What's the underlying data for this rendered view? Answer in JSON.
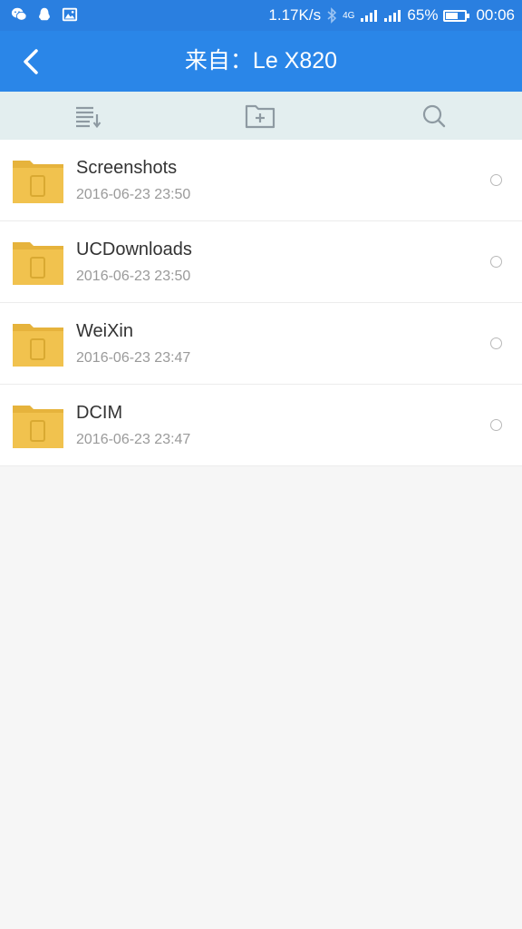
{
  "status_bar": {
    "speed": "1.17K/s",
    "network": "4G",
    "battery_percent": "65%",
    "battery_level": 0.65,
    "time": "00:06",
    "icons": [
      "wechat-icon",
      "qq-icon",
      "gallery-icon",
      "bluetooth-icon",
      "signal-icon",
      "battery-icon"
    ]
  },
  "app_bar": {
    "title": "来自：Le X820",
    "back_icon": "chevron-left-icon"
  },
  "toolbar": {
    "icons": [
      "sort-list-icon",
      "new-folder-icon",
      "search-icon"
    ]
  },
  "files": [
    {
      "name": "Screenshots",
      "date": "2016-06-23  23:50"
    },
    {
      "name": "UCDownloads",
      "date": "2016-06-23  23:50"
    },
    {
      "name": "WeiXin",
      "date": "2016-06-23  23:47"
    },
    {
      "name": "DCIM",
      "date": "2016-06-23  23:47"
    }
  ],
  "colors": {
    "status_bar": "#2a7fe0",
    "app_bar": "#2a86e8",
    "toolbar": "#e3eeef",
    "folder": "#f1c24e",
    "background": "#f6f6f6"
  }
}
